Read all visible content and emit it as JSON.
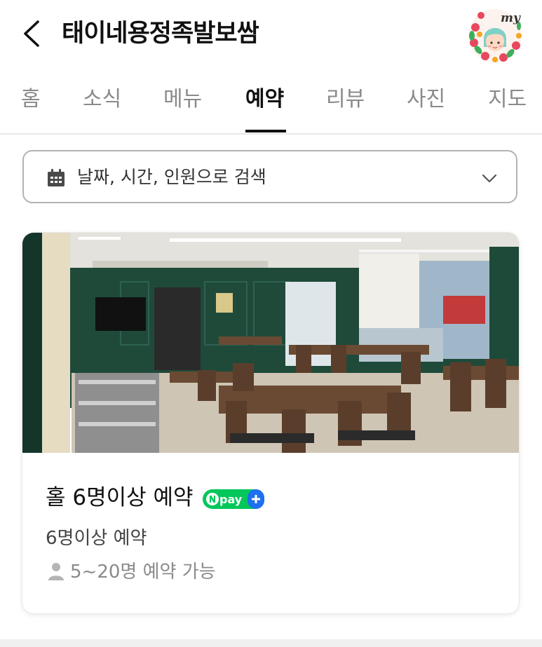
{
  "header": {
    "title": "태이네용정족발보쌈",
    "my_badge_text": "my"
  },
  "tabs": [
    {
      "label": "홈",
      "active": false
    },
    {
      "label": "소식",
      "active": false
    },
    {
      "label": "메뉴",
      "active": false
    },
    {
      "label": "예약",
      "active": true
    },
    {
      "label": "리뷰",
      "active": false
    },
    {
      "label": "사진",
      "active": false
    },
    {
      "label": "지도",
      "active": false
    }
  ],
  "search": {
    "text": "날짜, 시간, 인원으로 검색",
    "icon": "calendar-icon",
    "dropdown_icon": "chevron-down-icon"
  },
  "reservation_card": {
    "title": "홀 6명이상 예약",
    "badge_text": "pay",
    "badge_color": "#03c75a",
    "badge_plus_color": "#1e6ff1",
    "subtitle": "6명이상 예약",
    "capacity": "5~20명 예약 가능",
    "capacity_icon": "person-icon"
  }
}
